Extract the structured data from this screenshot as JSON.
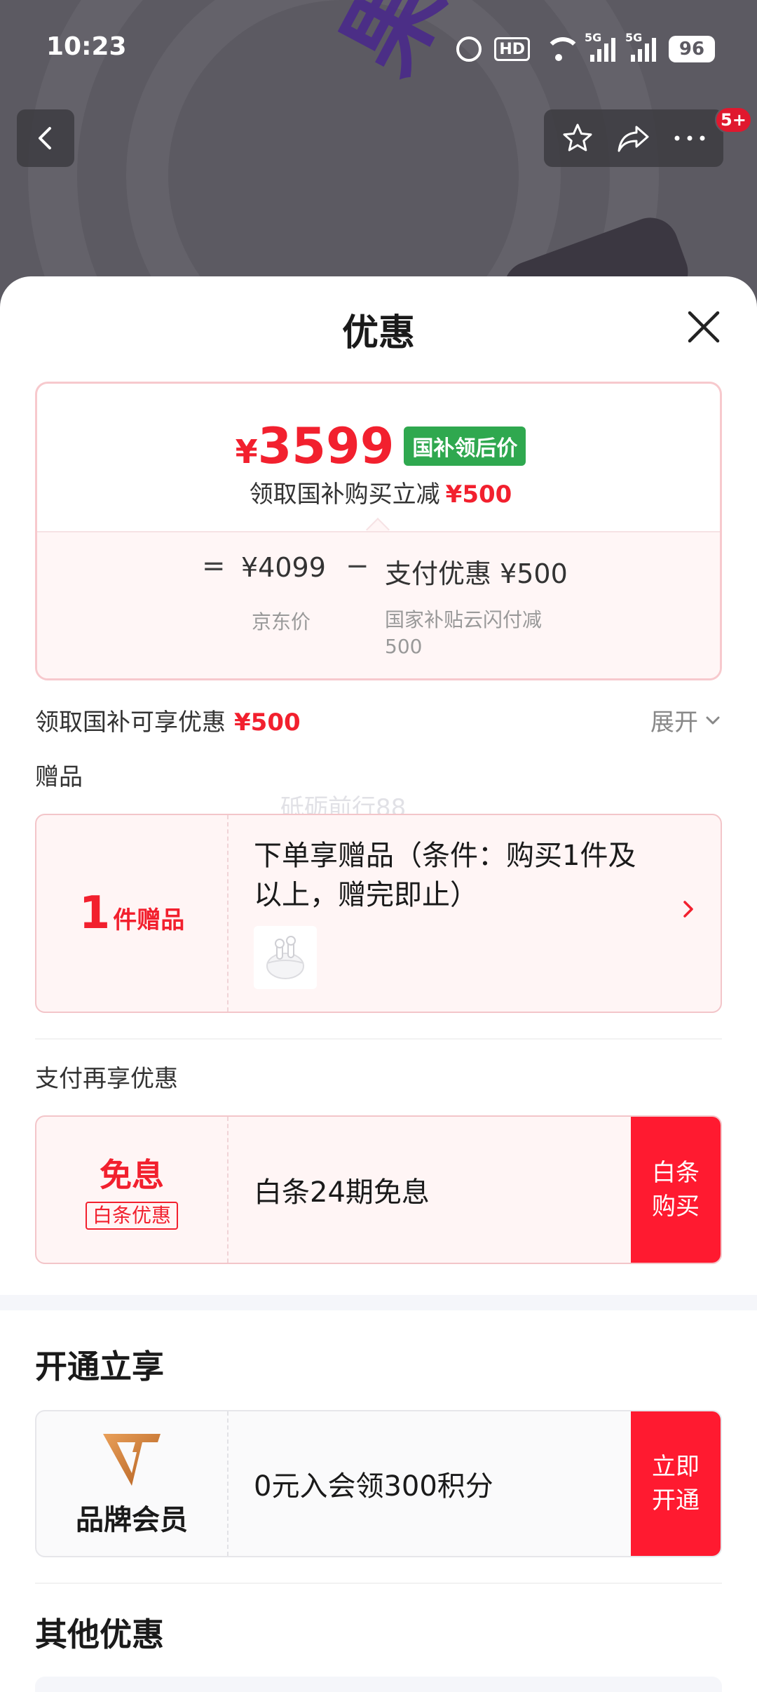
{
  "status_bar": {
    "time": "10:23",
    "hd_label": "HD",
    "network_5g": "5G",
    "battery": "96"
  },
  "hero": {
    "slogan": "果然好看"
  },
  "nav": {
    "badge": "5+"
  },
  "sheet": {
    "title": "优惠",
    "price_card": {
      "currency": "¥",
      "price": "3599",
      "tag": "国补领后价",
      "subtitle": "领取国补购买立减",
      "subtitle_amount": "¥500",
      "equals": "=",
      "minus": "−",
      "jd_price": "¥4099",
      "jd_price_label": "京东价",
      "pay_discount": "支付优惠 ¥500",
      "pay_discount_label": "国家补贴云闪付减500"
    },
    "discount_row": {
      "label": "领取国补可享优惠",
      "amount": "¥500",
      "expand": "展开"
    },
    "gift_section": {
      "label": "赠品",
      "watermark": "砥砺前行88",
      "count": "1",
      "count_unit": "件赠品",
      "text": "下单享赠品（条件：购买1件及以上，赠完即止）"
    },
    "payment_section": {
      "label": "支付再享优惠",
      "coupon_title": "免息",
      "coupon_badge": "白条优惠",
      "coupon_text": "白条24期免息",
      "action": "白条购买"
    },
    "membership_section": {
      "title": "开通立享",
      "name": "品牌会员",
      "text": "0元入会领300积分",
      "action": "立即开通"
    },
    "other_section": {
      "title": "其他优惠"
    }
  },
  "colors": {
    "accent_red": "#f2202e",
    "action_red": "#ff1a30",
    "tag_green": "#2fa84f",
    "member_gold": "#c8742a"
  }
}
